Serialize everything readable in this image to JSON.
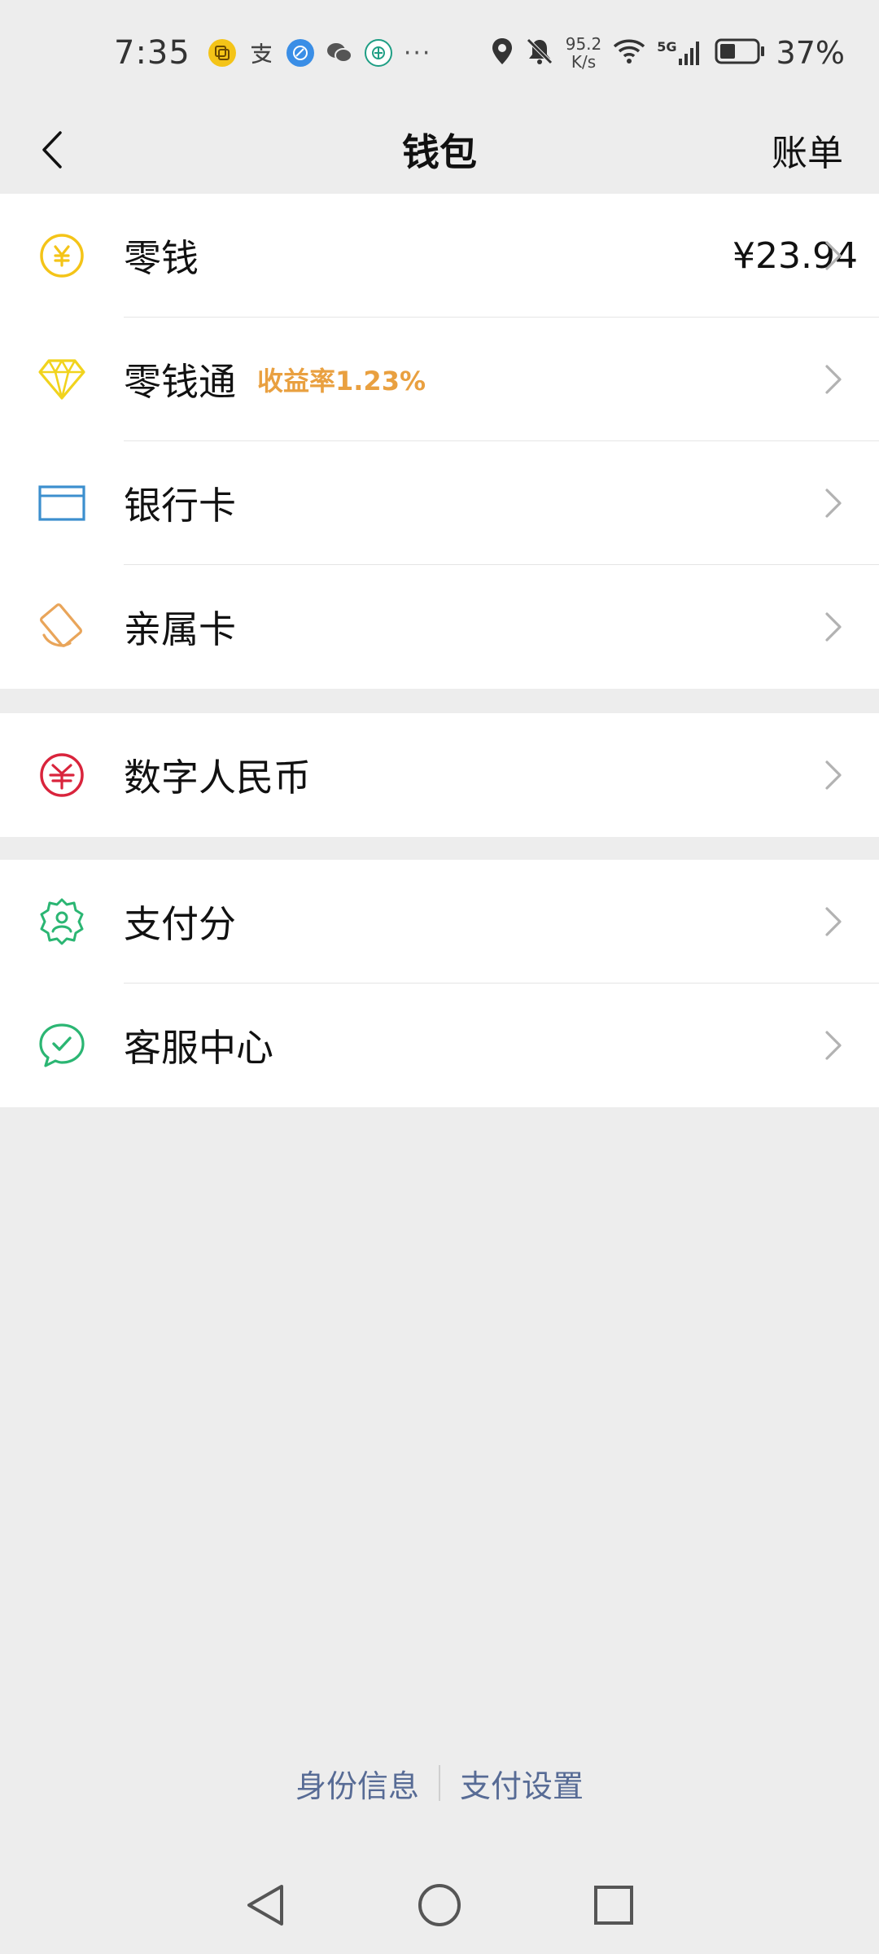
{
  "status_bar": {
    "time": "7:35",
    "network_speed_value": "95.2",
    "network_speed_unit": "K/s",
    "network_type": "5G",
    "battery_percent": "37%"
  },
  "nav": {
    "title": "钱包",
    "bill_label": "账单"
  },
  "groups": [
    {
      "items": [
        {
          "label": "零钱",
          "value": "¥23.94",
          "icon": "yuan-coin-icon",
          "color": "#f4c418"
        },
        {
          "label": "零钱通",
          "badge": "收益率1.23%",
          "icon": "diamond-icon",
          "color": "#f1d31d"
        },
        {
          "label": "银行卡",
          "icon": "bank-card-icon",
          "color": "#3c8fce"
        },
        {
          "label": "亲属卡",
          "icon": "family-card-icon",
          "color": "#e9a55a"
        }
      ]
    },
    {
      "items": [
        {
          "label": "数字人民币",
          "icon": "digital-rmb-icon",
          "color": "#d9243c"
        }
      ]
    },
    {
      "items": [
        {
          "label": "支付分",
          "icon": "pay-score-icon",
          "color": "#2bb673"
        },
        {
          "label": "客服中心",
          "icon": "customer-service-icon",
          "color": "#2bb673"
        }
      ]
    }
  ],
  "footer": {
    "identity_label": "身份信息",
    "payment_settings_label": "支付设置"
  },
  "colors": {
    "background": "#ededed",
    "link": "#576b95",
    "badge": "#e9a040"
  }
}
